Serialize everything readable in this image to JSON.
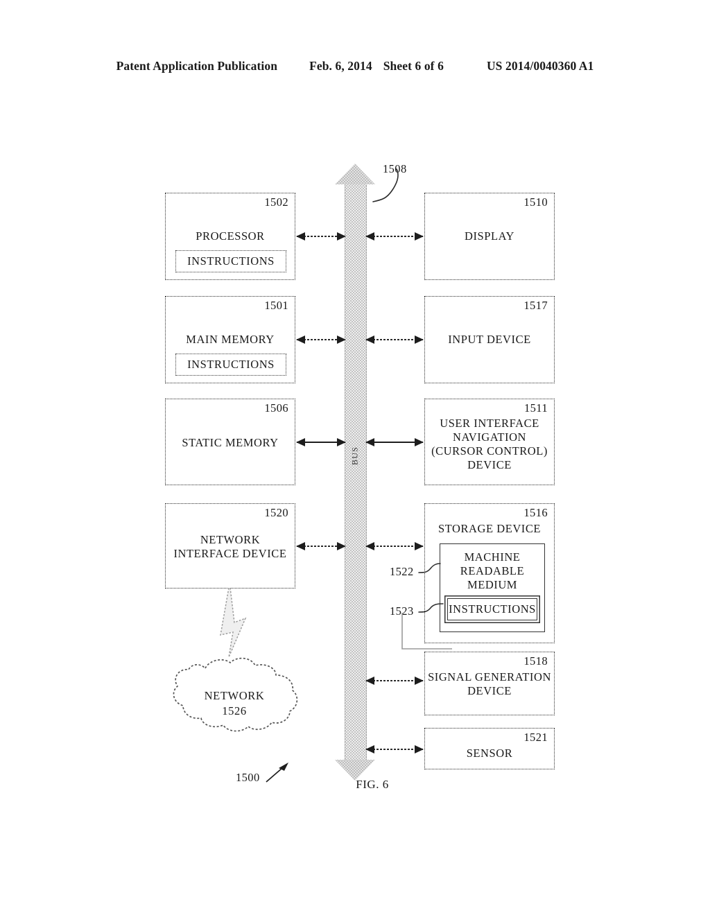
{
  "header": {
    "publication": "Patent Application Publication",
    "date": "Feb. 6, 2014",
    "sheet": "Sheet 6 of 6",
    "patent_number": "US 2014/0040360 A1"
  },
  "figure": {
    "caption": "FIG. 6",
    "system_ref": "1500",
    "bus": {
      "ref": "1508",
      "label": "BUS"
    },
    "network_cloud": {
      "label": "NETWORK",
      "ref": "1526"
    },
    "blocks": {
      "processor": {
        "ref": "1502",
        "label": "PROCESSOR",
        "inner_label": "INSTRUCTIONS"
      },
      "main_memory": {
        "ref": "1501",
        "label": "MAIN MEMORY",
        "inner_label": "INSTRUCTIONS"
      },
      "static_memory": {
        "ref": "1506",
        "label": "STATIC MEMORY"
      },
      "network_interface_device": {
        "ref": "1520",
        "label_line1": "NETWORK",
        "label_line2": "INTERFACE DEVICE"
      },
      "display": {
        "ref": "1510",
        "label": "DISPLAY"
      },
      "input_device": {
        "ref": "1517",
        "label": "INPUT DEVICE"
      },
      "user_interface_navigation": {
        "ref": "1511",
        "label_line1": "USER INTERFACE",
        "label_line2": "NAVIGATION",
        "label_line3": "(CURSOR CONTROL)",
        "label_line4": "DEVICE"
      },
      "storage_device": {
        "ref": "1516",
        "label": "STORAGE DEVICE",
        "machine_readable_medium": {
          "ref": "1522",
          "label_line1": "MACHINE",
          "label_line2": "READABLE",
          "label_line3": "MEDIUM"
        },
        "instructions": {
          "ref": "1523",
          "label": "INSTRUCTIONS"
        }
      },
      "signal_generation_device": {
        "ref": "1518",
        "label_line1": "SIGNAL GENERATION",
        "label_line2": "DEVICE"
      },
      "sensor": {
        "ref": "1521",
        "label": "SENSOR"
      }
    }
  },
  "colors": {
    "ink": "#1a1a1a",
    "bus_fill": "#e9e9e9",
    "paper": "#ffffff"
  }
}
